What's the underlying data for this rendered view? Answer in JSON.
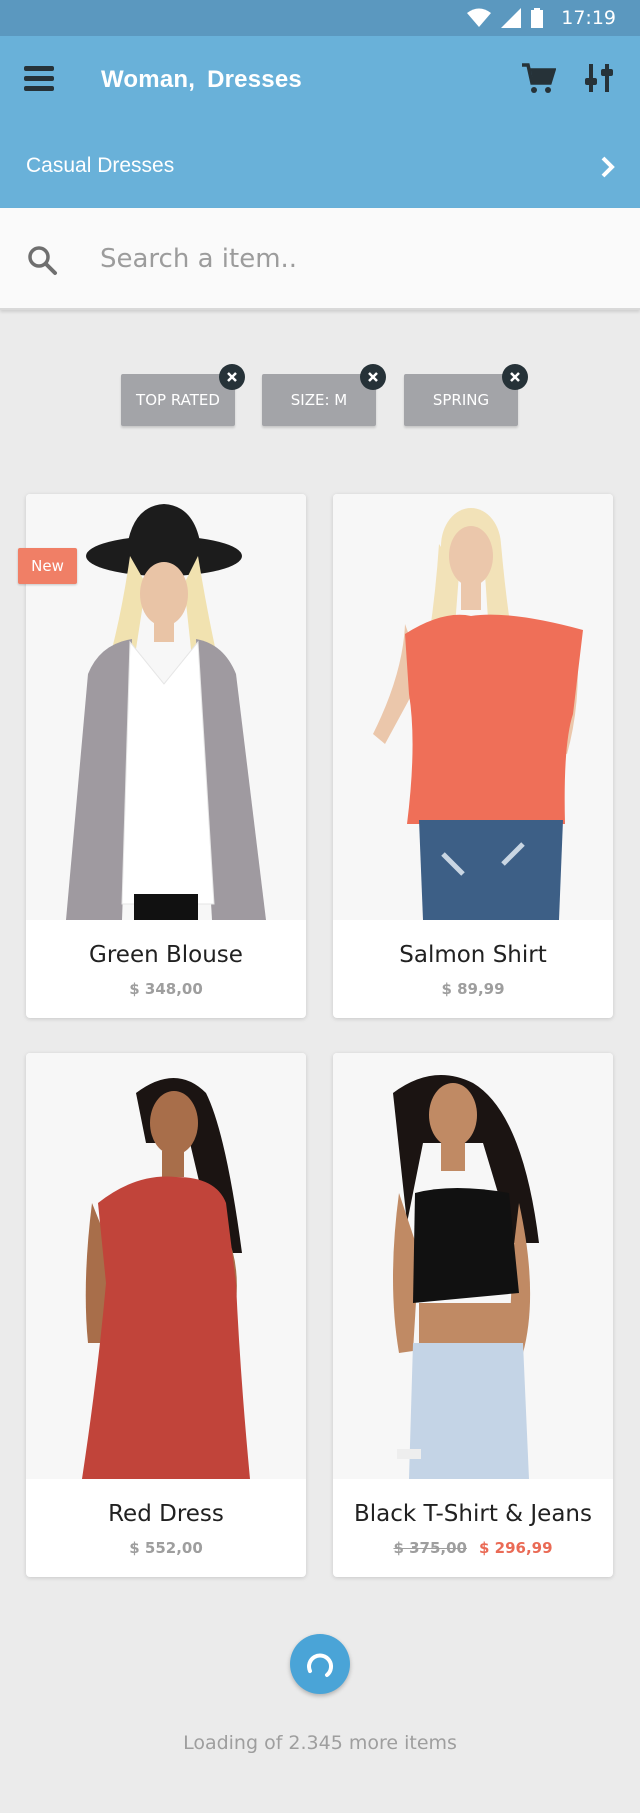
{
  "status_bar": {
    "time": "17:19",
    "icons": [
      "wifi-icon",
      "signal-icon",
      "battery-icon"
    ]
  },
  "app_bar": {
    "title_part1": "Woman,",
    "title_part2": "Dresses",
    "subcategory": "Casual Dresses",
    "actions": [
      "cart-icon",
      "filter-sliders-icon"
    ],
    "background_color": "#69b1d9"
  },
  "search": {
    "placeholder": "Search a item.."
  },
  "filters": [
    {
      "label": "TOP RATED"
    },
    {
      "label": "SIZE: M"
    },
    {
      "label": "SPRING"
    }
  ],
  "products": [
    {
      "name": "Green Blouse",
      "price": "$ 348,00",
      "badge": "New"
    },
    {
      "name": "Salmon Shirt",
      "price": "$ 89,99"
    },
    {
      "name": "Red Dress",
      "price": "$ 552,00"
    },
    {
      "name": "Black T-Shirt & Jeans",
      "old_price": "$ 375,00",
      "price": "$ 296,99"
    }
  ],
  "footer": {
    "loading_text": "Loading of 2.345 more items"
  },
  "colors": {
    "accent": "#4aa4d7",
    "sale": "#ea6a55",
    "badge": "#f07f66"
  }
}
